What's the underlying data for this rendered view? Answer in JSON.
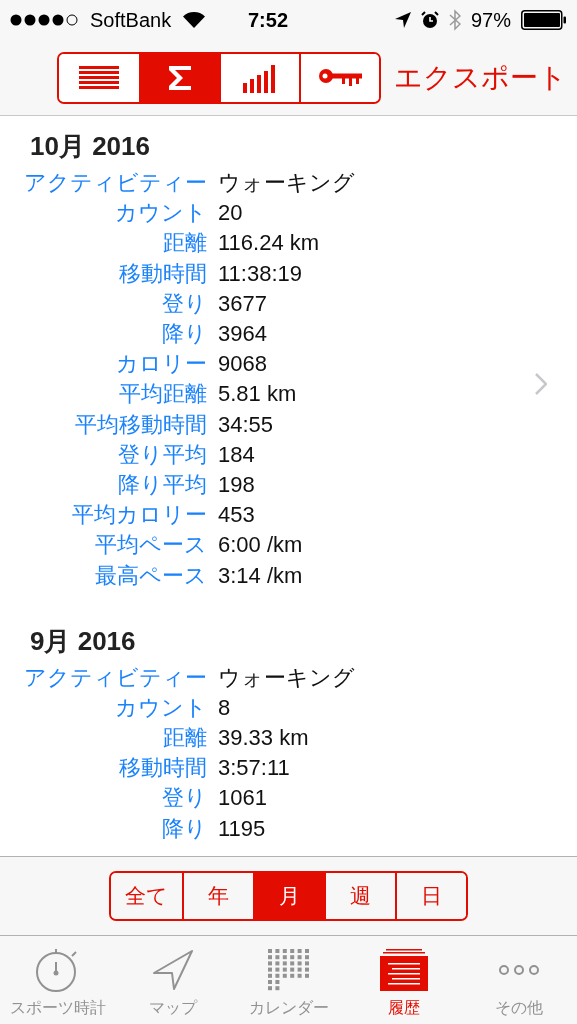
{
  "status_bar": {
    "carrier": "SoftBank",
    "time": "7:52",
    "battery": "97%"
  },
  "toolbar": {
    "segments": [
      {
        "kind": "list",
        "selected": false
      },
      {
        "kind": "sum",
        "selected": true
      },
      {
        "kind": "bars",
        "selected": false
      },
      {
        "kind": "key",
        "selected": false
      }
    ],
    "export": "エクスポート"
  },
  "sections": [
    {
      "title": "10月 2016",
      "rows": [
        {
          "label": "アクティビティー",
          "value": "ウォーキング"
        },
        {
          "label": "カウント",
          "value": "20"
        },
        {
          "label": "距離",
          "value": "116.24 km"
        },
        {
          "label": "移動時間",
          "value": "11:38:19"
        },
        {
          "label": "登り",
          "value": "3677"
        },
        {
          "label": "降り",
          "value": "3964"
        },
        {
          "label": "カロリー",
          "value": "9068"
        },
        {
          "label": "平均距離",
          "value": "5.81 km"
        },
        {
          "label": "平均移動時間",
          "value": "34:55"
        },
        {
          "label": "登り平均",
          "value": "184"
        },
        {
          "label": "降り平均",
          "value": "198"
        },
        {
          "label": "平均カロリー",
          "value": "453"
        },
        {
          "label": "平均ペース",
          "value": "6:00 /km"
        },
        {
          "label": "最高ペース",
          "value": "3:14 /km"
        }
      ]
    },
    {
      "title": "9月 2016",
      "rows": [
        {
          "label": "アクティビティー",
          "value": "ウォーキング"
        },
        {
          "label": "カウント",
          "value": "8"
        },
        {
          "label": "距離",
          "value": "39.33 km"
        },
        {
          "label": "移動時間",
          "value": "3:57:11"
        },
        {
          "label": "登り",
          "value": "1061"
        },
        {
          "label": "降り",
          "value": "1195"
        }
      ]
    }
  ],
  "period_selector": [
    {
      "label": "全て",
      "selected": false
    },
    {
      "label": "年",
      "selected": false
    },
    {
      "label": "月",
      "selected": true
    },
    {
      "label": "週",
      "selected": false
    },
    {
      "label": "日",
      "selected": false
    }
  ],
  "tab_bar": [
    {
      "kind": "stopwatch",
      "label": "スポーツ時計",
      "selected": false
    },
    {
      "kind": "map",
      "label": "マップ",
      "selected": false
    },
    {
      "kind": "calendar",
      "label": "カレンダー",
      "selected": false
    },
    {
      "kind": "history",
      "label": "履歴",
      "selected": true
    },
    {
      "kind": "more",
      "label": "その他",
      "selected": false
    }
  ]
}
